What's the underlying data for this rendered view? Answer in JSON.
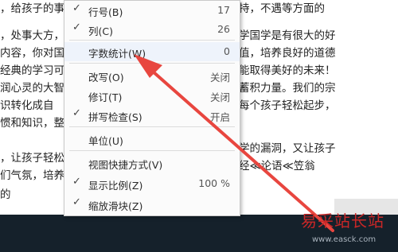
{
  "document": {
    "lines_left": [
      "，给孩子的事习",
      "，处事大方，",
      "内容，你对国",
      "经典的学习可",
      "润心灵的大智",
      "识转化成自",
      "惯和知识，整",
      "",
      "，让孩子轻松",
      "们气氛，培养",
      "的"
    ],
    "lines_right": [
      "持，不遇等方面的",
      "学国学是有很大的好",
      "值，培养良好的道德",
      "能取得美好的未来！",
      "蓄积力量。我们的宗",
      "每个孩子轻松起步，",
      "",
      "学的漏洞，又让孩子",
      "经≪论语≪笠翁"
    ]
  },
  "context_menu": {
    "items": [
      {
        "checked": true,
        "label": "行号(B)",
        "value": "17"
      },
      {
        "checked": true,
        "label": "列(C)",
        "value": "26"
      },
      {
        "checked": false,
        "label": "字数统计(W)",
        "value": "0"
      },
      {
        "checked": false,
        "label": "改写(O)",
        "value": "关闭"
      },
      {
        "checked": false,
        "label": "修订(T)",
        "value": "关闭"
      },
      {
        "checked": true,
        "label": "拼写检查(S)",
        "value": "开启"
      },
      {
        "checked": false,
        "label": "单位(U)",
        "value": ""
      },
      {
        "checked": false,
        "label": "视图快捷方式(V)",
        "value": ""
      },
      {
        "checked": true,
        "label": "显示比例(Z)",
        "value": "100 %"
      },
      {
        "checked": true,
        "label": "缩放滑块(Z)",
        "value": ""
      }
    ],
    "check_glyph": "✓"
  },
  "annotation": {
    "arrow_color": "#e8463f",
    "icon": "red-arrow-annotation"
  },
  "watermark": {
    "title": "易采站长站",
    "url": "www.easck.com",
    "color": "#c92727"
  },
  "taskbar": {
    "color": "#15212b"
  }
}
